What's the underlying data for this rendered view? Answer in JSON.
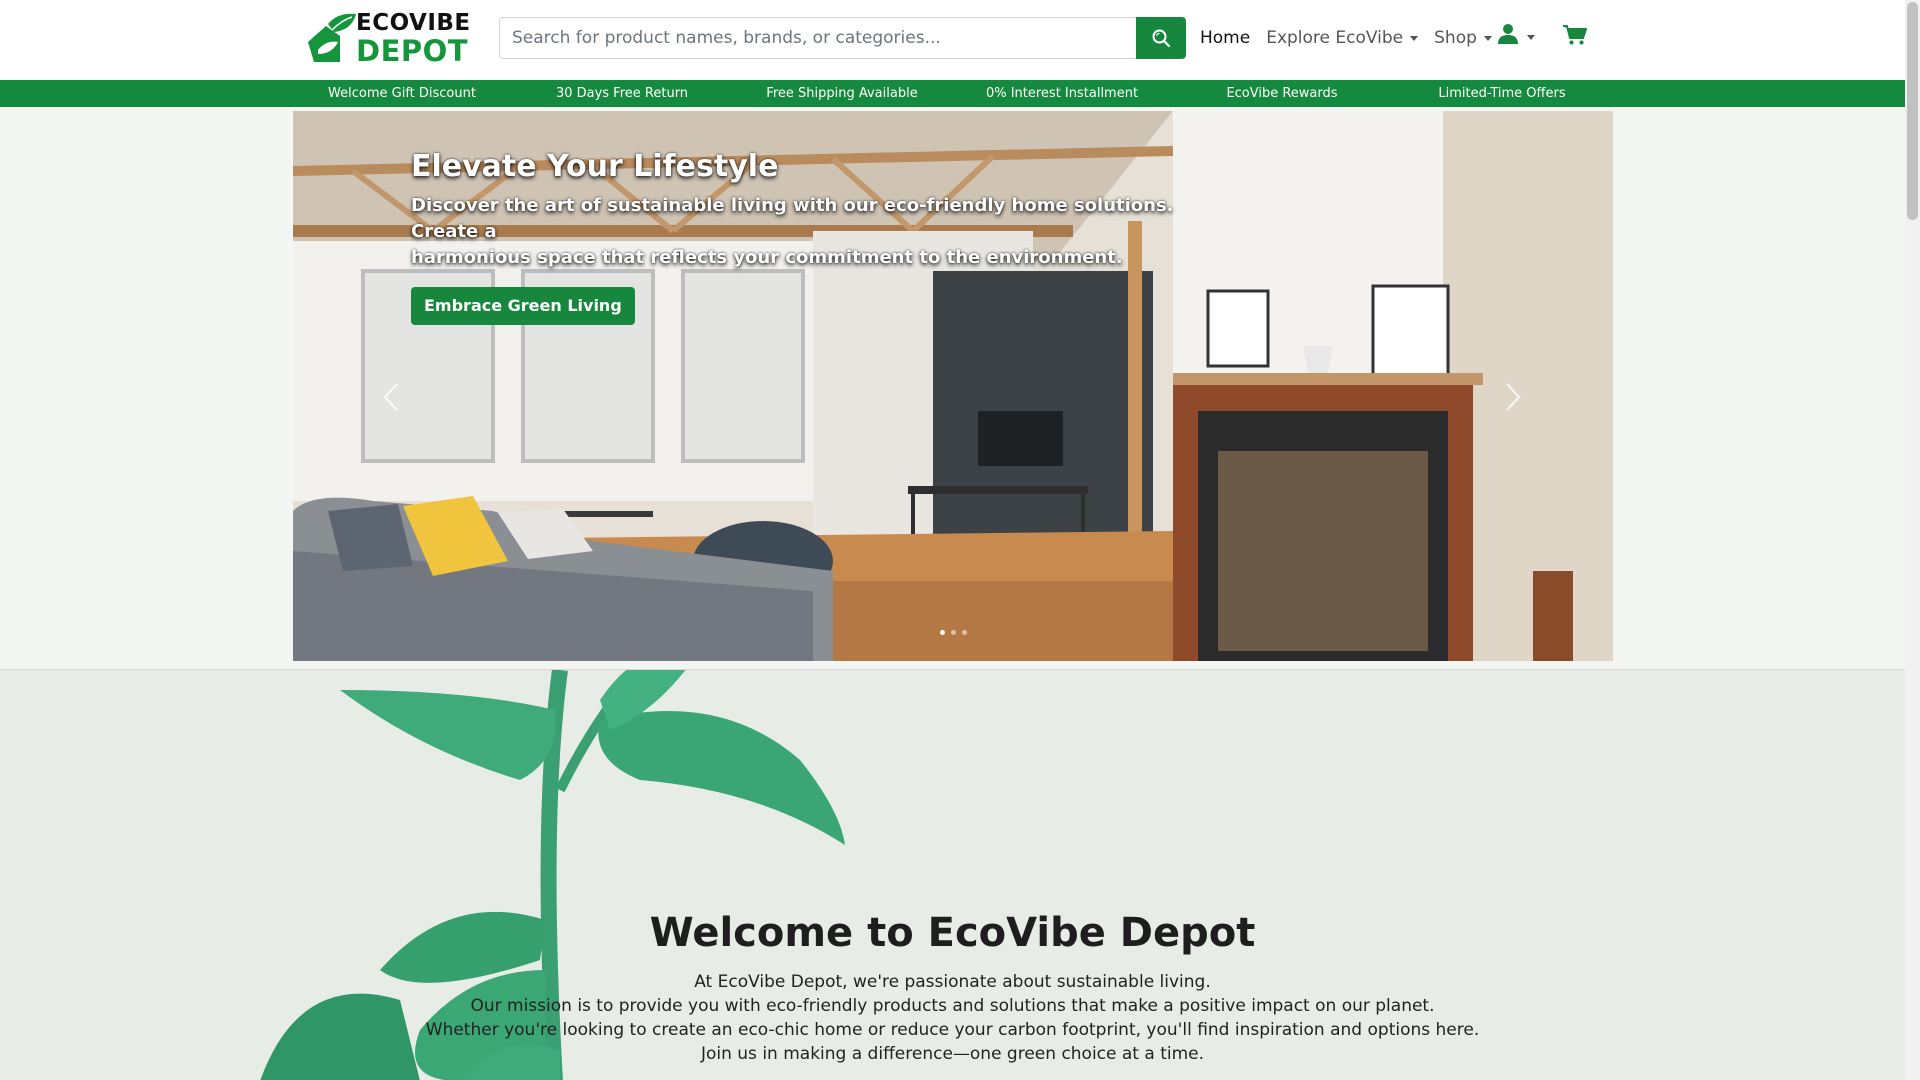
{
  "brand": {
    "name_line1": "ECOVIBE",
    "name_line2": "DEPOT",
    "accent_color": "#16873d"
  },
  "search": {
    "placeholder": "Search for product names, brands, or categories...",
    "value": "",
    "button_icon": "search-icon"
  },
  "nav": {
    "items": [
      {
        "label": "Home",
        "active": true,
        "dropdown": false
      },
      {
        "label": "Explore EcoVibe",
        "active": false,
        "dropdown": true
      },
      {
        "label": "Shop",
        "active": false,
        "dropdown": true
      }
    ],
    "user_icon": "user-icon",
    "cart_icon": "cart-icon"
  },
  "promos": [
    "Welcome Gift Discount",
    "30 Days Free Return",
    "Free Shipping Available",
    "0% Interest Installment",
    "EcoVibe Rewards",
    "Limited-Time Offers"
  ],
  "hero": {
    "title": "Elevate Your Lifestyle",
    "text_line1": "Discover the art of sustainable living with our eco-friendly home solutions. Create a",
    "text_line2": "harmonious space that reflects your commitment to the environment.",
    "cta": "Embrace Green Living",
    "prev_icon": "chevron-left-icon",
    "next_icon": "chevron-right-icon",
    "slides_count": 3,
    "active_slide": 1
  },
  "welcome": {
    "title": "Welcome to EcoVibe Depot",
    "lines": [
      "At EcoVibe Depot, we're passionate about sustainable living.",
      "Our mission is to provide you with eco-friendly products and solutions that make a positive impact on our planet.",
      "Whether you're looking to create an eco-chic home or reduce your carbon footprint, you'll find inspiration and options here.",
      "Join us in making a difference—one green choice at a time."
    ]
  }
}
